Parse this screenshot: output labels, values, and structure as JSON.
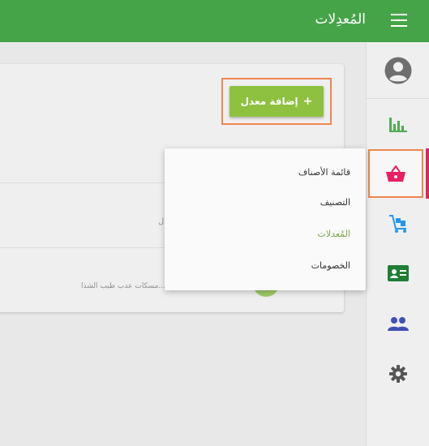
{
  "header": {
    "title": "المُعدِلات"
  },
  "sidebar": {
    "items": [
      {
        "icon": "account-circle-icon",
        "color": "#6e6e6e"
      },
      {
        "icon": "bar-chart-icon",
        "color": "#4caf50"
      },
      {
        "icon": "shopping-basket-icon",
        "color": "#e91e63"
      },
      {
        "icon": "delivery-cart-icon",
        "color": "#2196f3"
      },
      {
        "icon": "id-card-icon",
        "color": "#1e7e34"
      },
      {
        "icon": "group-icon",
        "color": "#3f51b5"
      },
      {
        "icon": "gear-icon",
        "color": "#555555"
      }
    ]
  },
  "main": {
    "add_button": {
      "plus": "+",
      "label": "إضافة معدل"
    },
    "row_char": "ل",
    "row_snippet": "...و...مسكات عدب طيب الشذا"
  },
  "dropdown": {
    "items": [
      {
        "label": "قائمة الأصناف"
      },
      {
        "label": "التصنيف"
      },
      {
        "label": "المُعدلات"
      },
      {
        "label": "الخصومات"
      }
    ]
  },
  "colors": {
    "topbar": "#45a447",
    "accent": "#8dc13f",
    "highlight": "#f0864f"
  }
}
